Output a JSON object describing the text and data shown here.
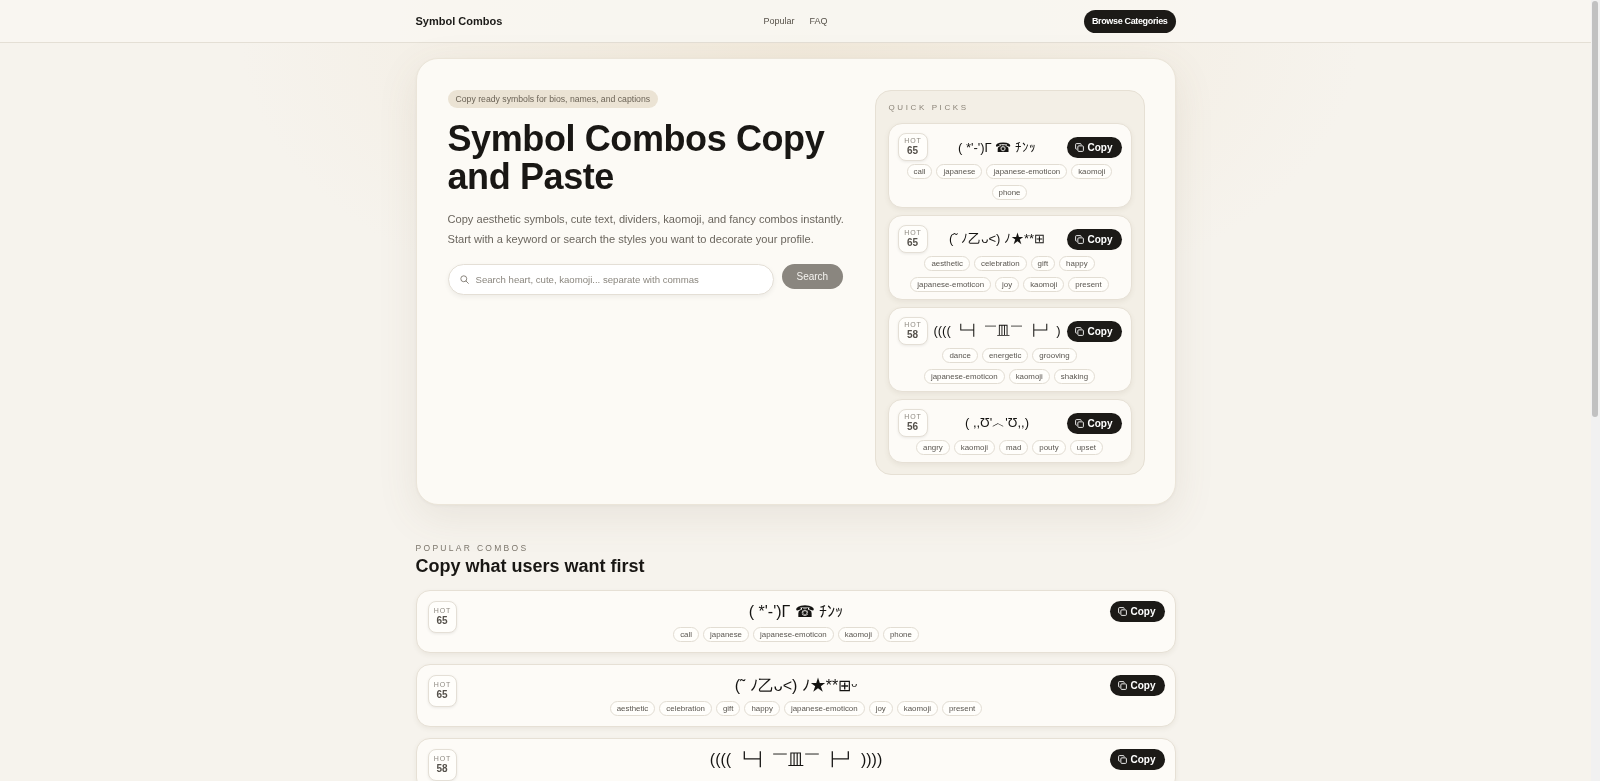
{
  "header": {
    "logo": "Symbol Combos",
    "nav": [
      "Popular",
      "FAQ"
    ],
    "button": "Browse Categories"
  },
  "hero": {
    "badge": "Copy ready symbols for bios, names, and captions",
    "title": "Symbol Combos Copy and Paste",
    "description": "Copy aesthetic symbols, cute text, dividers, kaomoji, and fancy combos instantly. Start with a keyword or search the styles you want to decorate your profile.",
    "search": {
      "placeholder": "Search heart, cute, kaomoji... separate with commas",
      "button": {
        "label": "Search",
        "disabled": true
      }
    }
  },
  "quick_picks": {
    "label": "QUICK PICKS",
    "items": [
      {
        "hot": "HOT",
        "score": "65",
        "combo": "( *'-')Γ ☎ ﾁﾝｯ",
        "copy": "Copy",
        "tags": [
          "call",
          "japanese",
          "japanese-emoticon",
          "kaomoji",
          "phone"
        ]
      },
      {
        "hot": "HOT",
        "score": "65",
        "combo": "(˜ ﾉ乙ᴗ<) ﾉ★**⊞",
        "copy": "Copy",
        "tags": [
          "aesthetic",
          "celebration",
          "gift",
          "happy",
          "japanese-emoticon",
          "joy",
          "kaomoji",
          "present"
        ]
      },
      {
        "hot": "HOT",
        "score": "58",
        "combo": "(((( ┗┫ ￣皿￣ ┣┛ )",
        "copy": "Copy",
        "tags": [
          "dance",
          "energetic",
          "grooving",
          "japanese-emoticon",
          "kaomoji",
          "shaking"
        ]
      },
      {
        "hot": "HOT",
        "score": "56",
        "combo": "( ,,Ʊ'︿'Ʊ,,)",
        "copy": "Copy",
        "tags": [
          "angry",
          "kaomoji",
          "mad",
          "pouty",
          "upset"
        ]
      }
    ]
  },
  "popular": {
    "eyebrow": "POPULAR COMBOS",
    "title": "Copy what users want first",
    "items": [
      {
        "hot": "HOT",
        "score": "65",
        "combo": "( *'-')Γ ☎ ﾁﾝｯ",
        "copy": "Copy",
        "tags": [
          "call",
          "japanese",
          "japanese-emoticon",
          "kaomoji",
          "phone"
        ]
      },
      {
        "hot": "HOT",
        "score": "65",
        "combo": "(˜ ﾉ乙ᴗ<) ﾉ★**⊞ᵕ",
        "copy": "Copy",
        "tags": [
          "aesthetic",
          "celebration",
          "gift",
          "happy",
          "japanese-emoticon",
          "joy",
          "kaomoji",
          "present"
        ]
      },
      {
        "hot": "HOT",
        "score": "58",
        "combo": "(((( ┗┫ ￣皿￣ ┣┛ ))))",
        "copy": "Copy"
      }
    ]
  }
}
